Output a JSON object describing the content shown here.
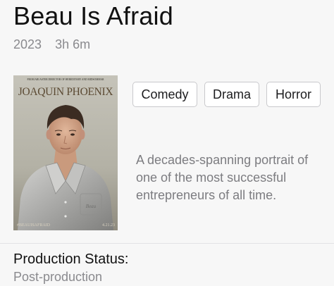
{
  "movie": {
    "title": "Beau Is Afraid",
    "year": "2023",
    "runtime": "3h 6m",
    "genres": [
      "Comedy",
      "Drama",
      "Horror"
    ],
    "description": "A decades-spanning portrait of one of the most successful entrepreneurs of all time."
  },
  "poster": {
    "credit_line": "FROM ARI ASTER   DIRECTOR OF HEREDITARY AND MIDSOMMAR",
    "actor": "JOAQUIN PHOENIX",
    "hashtag": "#BEAUISAFRAID",
    "date": "4.21.23",
    "pajama_monogram": "Beau"
  },
  "production": {
    "heading": "Production Status:",
    "value": "Post-production"
  }
}
